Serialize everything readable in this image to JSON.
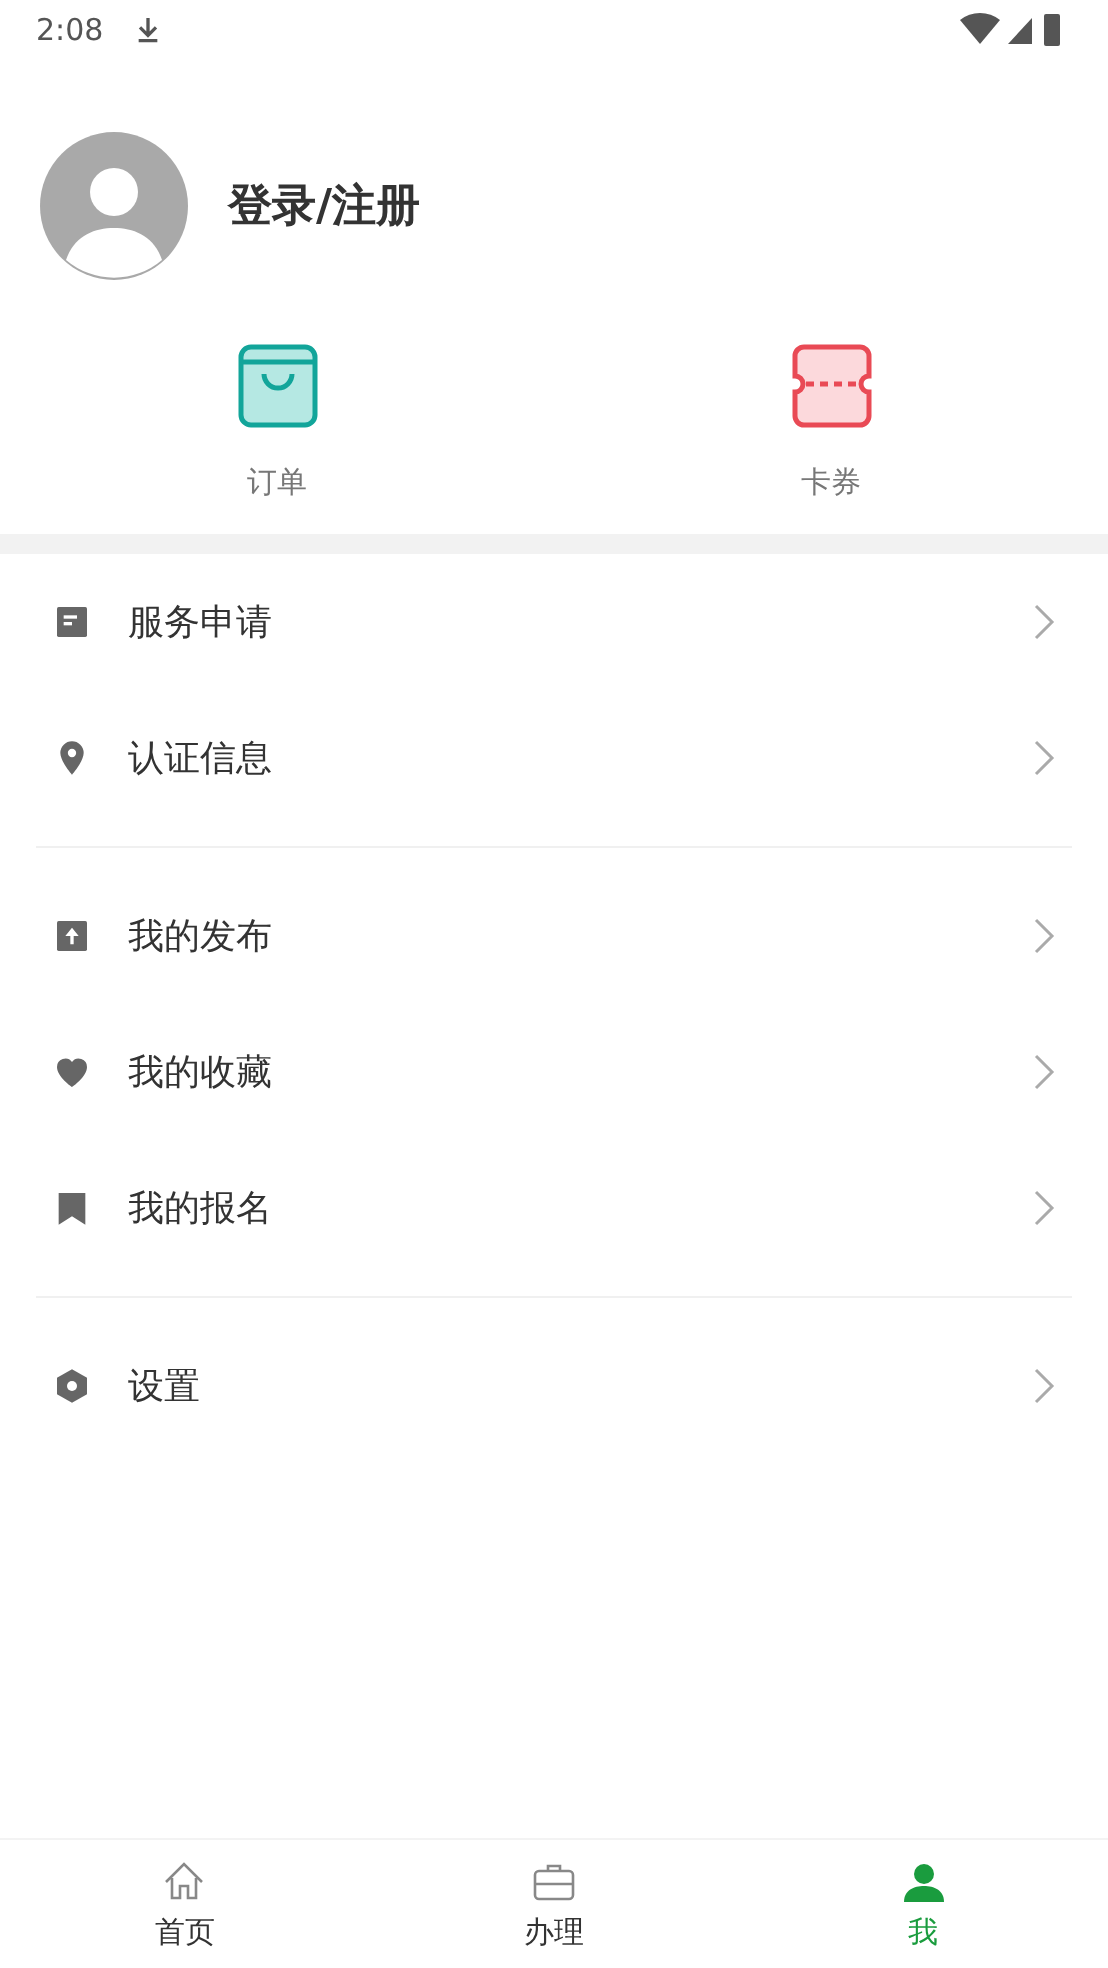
{
  "status_bar": {
    "time": "2:08"
  },
  "profile": {
    "login_label": "登录/注册"
  },
  "shortcuts": [
    {
      "kind": "bag",
      "label": "订单"
    },
    {
      "kind": "ticket",
      "label": "卡券"
    }
  ],
  "menu_groups": [
    [
      {
        "kind": "note",
        "label": "服务申请"
      },
      {
        "kind": "pin",
        "label": "认证信息"
      }
    ],
    [
      {
        "kind": "upload",
        "label": "我的发布"
      },
      {
        "kind": "heart",
        "label": "我的收藏"
      },
      {
        "kind": "bookmark",
        "label": "我的报名"
      }
    ],
    [
      {
        "kind": "hexagon",
        "label": "设置"
      }
    ]
  ],
  "bottom_nav": [
    {
      "kind": "home",
      "label": "首页",
      "selected": false
    },
    {
      "kind": "briefcase",
      "label": "办理",
      "selected": false
    },
    {
      "kind": "person",
      "label": "我",
      "selected": true
    }
  ]
}
